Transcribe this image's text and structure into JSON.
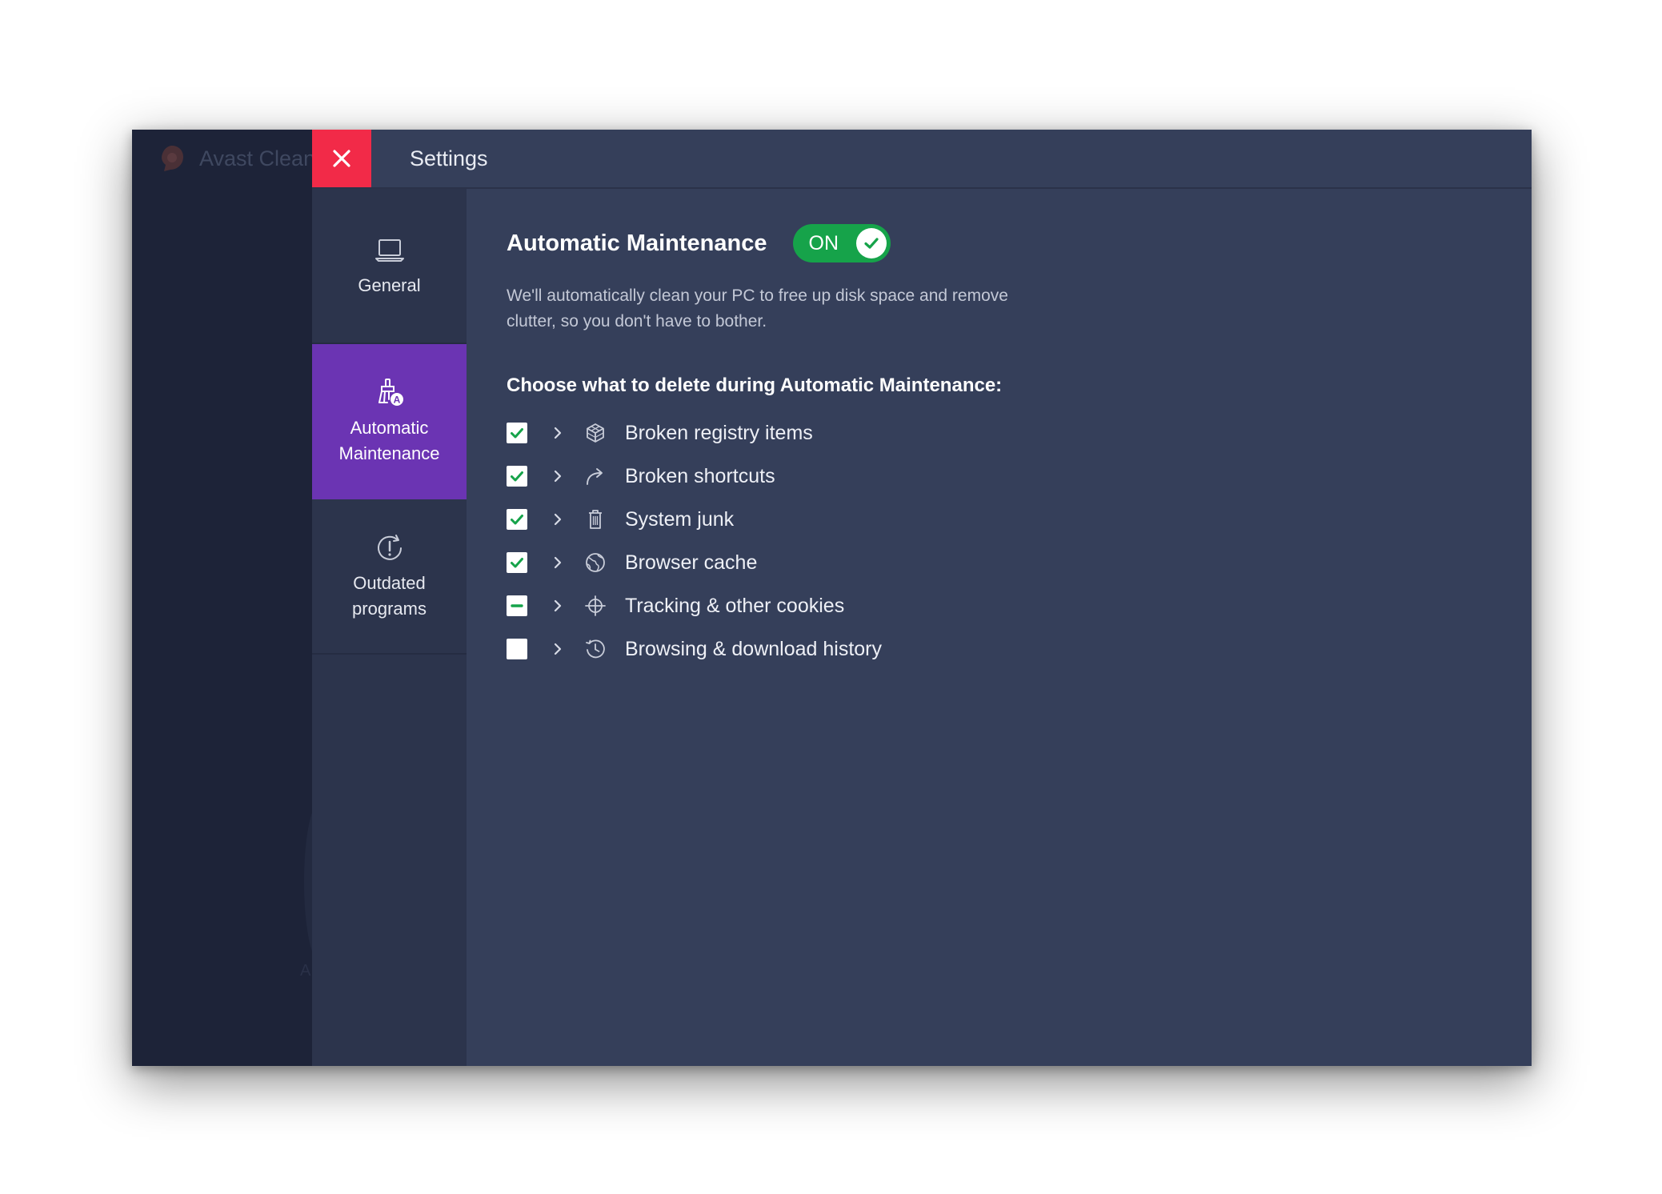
{
  "background_app": {
    "title": "Avast Clean",
    "logo_icon": "avast-logo-icon",
    "small_text": "A"
  },
  "header": {
    "close_icon": "close-icon",
    "title": "Settings"
  },
  "nav": {
    "items": [
      {
        "label": "General",
        "icon": "laptop-icon",
        "active": false
      },
      {
        "label": "Automatic Maintenance",
        "icon": "broom-auto-icon",
        "active": true
      },
      {
        "label": "Outdated programs",
        "icon": "update-alert-icon",
        "active": false
      }
    ]
  },
  "main": {
    "title": "Automatic Maintenance",
    "toggle": {
      "label": "ON",
      "state": "on"
    },
    "description": "We'll automatically clean your PC to free up disk space and remove clutter, so you don't have to bother.",
    "choose_heading": "Choose what to delete during Automatic Maintenance:",
    "items": [
      {
        "label": "Broken registry items",
        "icon": "cube-icon",
        "state": "checked"
      },
      {
        "label": "Broken shortcuts",
        "icon": "shortcut-arrow-icon",
        "state": "checked"
      },
      {
        "label": "System junk",
        "icon": "trash-icon",
        "state": "checked"
      },
      {
        "label": "Browser cache",
        "icon": "globe-icon",
        "state": "checked"
      },
      {
        "label": "Tracking & other cookies",
        "icon": "crosshair-icon",
        "state": "partial"
      },
      {
        "label": "Browsing & download history",
        "icon": "history-icon",
        "state": "unchecked"
      }
    ]
  },
  "colors": {
    "accent_close": "#f22a48",
    "active_nav": "#6b34b3",
    "toggle_on": "#16a34a",
    "check": "#16a34a",
    "content_bg": "#353f5a"
  }
}
